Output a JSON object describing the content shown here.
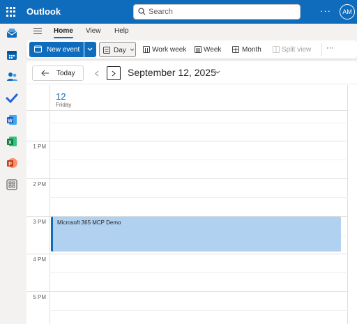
{
  "app": {
    "title": "Outlook",
    "avatar_initials": "AM"
  },
  "search": {
    "placeholder": "Search"
  },
  "topbar": {
    "more": "···"
  },
  "ribbon": {
    "tabs": [
      {
        "label": "Home"
      },
      {
        "label": "View"
      },
      {
        "label": "Help"
      }
    ],
    "new_event_label": "New event",
    "views": [
      {
        "label": "Day"
      },
      {
        "label": "Work week"
      },
      {
        "label": "Week"
      },
      {
        "label": "Month"
      },
      {
        "label": "Split view"
      }
    ],
    "more": "···"
  },
  "calendar": {
    "today_label": "Today",
    "date_title": "September 12, 2025",
    "day_number": "12",
    "day_name": "Friday",
    "hours": [
      "1 PM",
      "2 PM",
      "3 PM",
      "4 PM",
      "5 PM"
    ],
    "event": {
      "title": "Microsoft 365 MCP Demo",
      "color": "#b0d1f0",
      "accent": "#0f6cbd"
    }
  },
  "colors": {
    "brand": "#0f6cbd",
    "background": "#f3f2f1"
  }
}
